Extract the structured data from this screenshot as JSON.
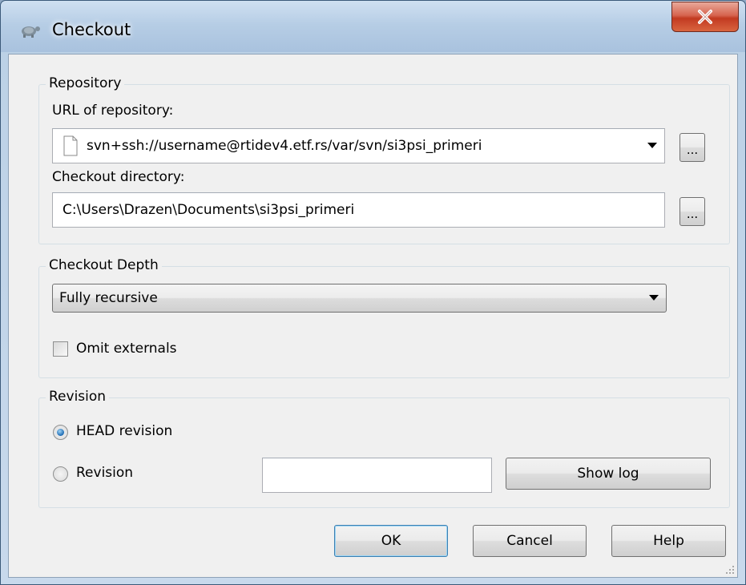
{
  "window": {
    "title": "Checkout",
    "close_glyph": "X",
    "title_icon": "tortoise-icon",
    "accent": "#c23a21"
  },
  "repository": {
    "legend": "Repository",
    "url_label": "URL of repository:",
    "url_value": "svn+ssh://username@rtidev4.etf.rs/var/svn/si3psi_primeri",
    "url_browse": "...",
    "dir_label": "Checkout directory:",
    "dir_value": "C:\\Users\\Drazen\\Documents\\si3psi_primeri",
    "dir_browse": "..."
  },
  "depth": {
    "legend": "Checkout Depth",
    "selected": "Fully recursive",
    "omit_externals": "Omit externals"
  },
  "revision": {
    "legend": "Revision",
    "head": "HEAD revision",
    "specific": "Revision",
    "revision_value": "",
    "show_log": "Show log"
  },
  "buttons": {
    "ok": "OK",
    "cancel": "Cancel",
    "help": "Help"
  }
}
